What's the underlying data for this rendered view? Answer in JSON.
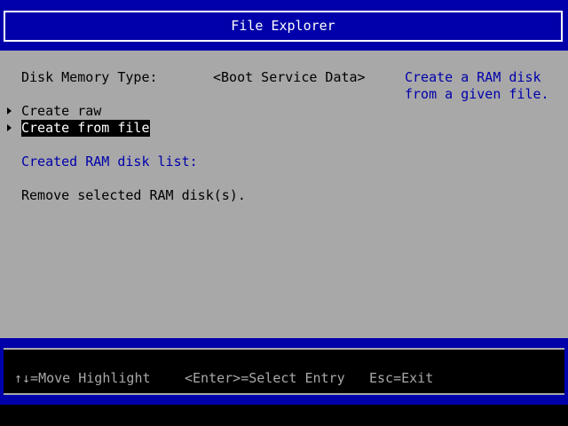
{
  "header": {
    "title": "File Explorer"
  },
  "form": {
    "disk_memory_type_label": "Disk Memory Type:",
    "disk_memory_type_value": "<Boot Service Data>",
    "help_text_line1": "Create a RAM disk",
    "help_text_line2": "from a given file.",
    "menu_items": [
      {
        "label": "Create raw",
        "selected": false
      },
      {
        "label": "Create from file",
        "selected": true
      }
    ],
    "created_list_heading": "Created RAM disk list:",
    "remove_label": "Remove selected RAM disk(s)."
  },
  "footer": {
    "move_hint": "↑↓=Move Highlight",
    "select_hint": "<Enter>=Select Entry",
    "exit_hint": "Esc=Exit"
  },
  "colors": {
    "bios_blue": "#0000aa",
    "panel_gray": "#a8a8a8",
    "text_black": "#000000",
    "text_white": "#ffffff"
  }
}
